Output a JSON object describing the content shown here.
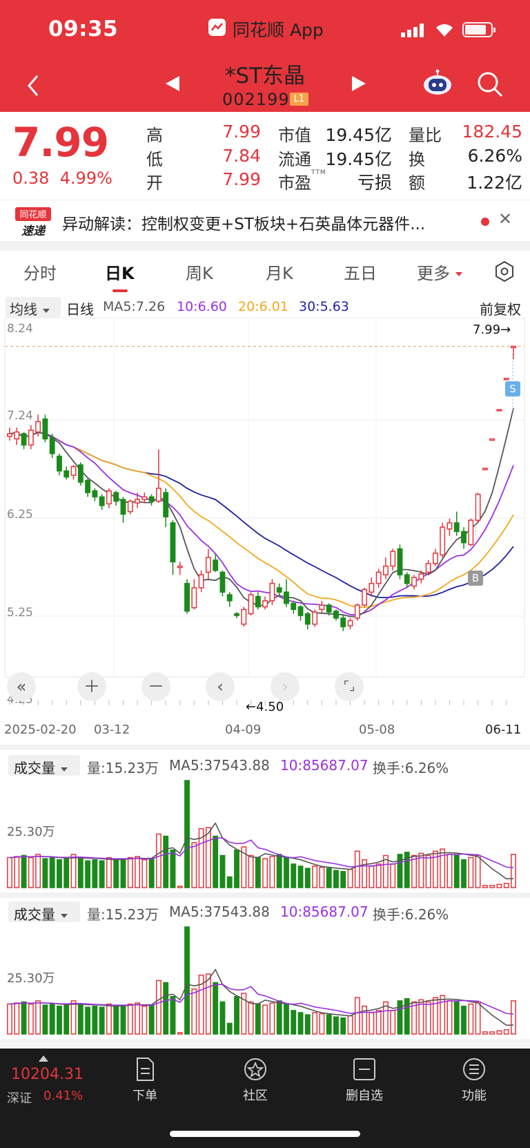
{
  "status": {
    "time": "09:35",
    "app": "同花顺 App"
  },
  "stock": {
    "name": "*ST东晶",
    "code": "002199",
    "level": "L1"
  },
  "quote": {
    "price": "7.99",
    "change": "0.38",
    "pct": "4.99%",
    "labels": {
      "high": "高",
      "low": "低",
      "open": "开",
      "mcap": "市值",
      "float": "流通",
      "pe": "市盈",
      "pe_sup": "TTM",
      "ratio": "量比",
      "turn": "换",
      "amount": "额"
    },
    "high": "7.99",
    "low": "7.84",
    "open": "7.99",
    "mcap": "19.45亿",
    "float": "19.45亿",
    "pe": "亏损",
    "ratio": "182.45",
    "turn": "6.26%",
    "amount": "1.22亿"
  },
  "news": {
    "badge_top": "同花顺",
    "badge_bottom": "速递",
    "text": "异动解读：控制权变更+ST板块+石英晶体元器件..."
  },
  "tabs": [
    "分时",
    "日K",
    "周K",
    "月K",
    "五日",
    "更多"
  ],
  "active_tab": 1,
  "ma_bar": {
    "selector": "均线",
    "period": "日线",
    "ma5": "MA5:7.26",
    "ma10": "10:6.60",
    "ma20": "20:6.01",
    "ma30": "30:5.63",
    "adjust": "前复权"
  },
  "price_axis": {
    "p1": "8.24",
    "p2": "7.24",
    "p3": "6.25",
    "p4": "5.25",
    "p5": "4.25",
    "max_label": "7.99→",
    "min_label": "←4.50"
  },
  "date_axis": [
    "2025-02-20",
    "03-12",
    "04-09",
    "05-08",
    "06-11"
  ],
  "markers": {
    "sell": "S",
    "buy": "B"
  },
  "volume_panels": [
    {
      "selector": "成交量",
      "vol": "量:15.23万",
      "ma5": "MA5:37543.88",
      "ma10": "10:85687.07",
      "turn": "换手:6.26%",
      "axis": "25.30万"
    },
    {
      "selector": "成交量",
      "vol": "量:15.23万",
      "ma5": "MA5:37543.88",
      "ma10": "10:85687.07",
      "turn": "换手:6.26%",
      "axis": "25.30万"
    }
  ],
  "footer": {
    "index_value": "10204.31",
    "index_name": "深证",
    "index_pct": "0.41%",
    "items": [
      "下单",
      "社区",
      "删自选",
      "功能"
    ]
  },
  "colors": {
    "brand_red": "#e5343b",
    "down_green": "#1a8a1a",
    "ma5": "#555555",
    "ma10": "#9b30e0",
    "ma20": "#f2a81d",
    "ma30": "#1f1fa0"
  },
  "chart_data": {
    "type": "candlestick",
    "title": "",
    "ylim": [
      4.25,
      8.24
    ],
    "x_ticks": [
      "2025-02-20",
      "03-12",
      "04-09",
      "05-08",
      "06-11"
    ],
    "candles": [
      [
        6.95,
        6.98,
        6.9,
        7.05
      ],
      [
        6.92,
        7.0,
        6.85,
        7.05
      ],
      [
        6.98,
        6.85,
        6.8,
        7.0
      ],
      [
        6.85,
        7.02,
        6.8,
        7.08
      ],
      [
        7.0,
        7.12,
        6.95,
        7.2
      ],
      [
        7.15,
        6.92,
        6.88,
        7.2
      ],
      [
        6.93,
        6.75,
        6.7,
        6.98
      ],
      [
        6.72,
        6.55,
        6.5,
        6.75
      ],
      [
        6.55,
        6.48,
        6.45,
        6.6
      ],
      [
        6.5,
        6.6,
        6.45,
        6.62
      ],
      [
        6.62,
        6.42,
        6.38,
        6.65
      ],
      [
        6.44,
        6.3,
        6.25,
        6.46
      ],
      [
        6.32,
        6.25,
        6.2,
        6.35
      ],
      [
        6.25,
        6.15,
        6.1,
        6.28
      ],
      [
        6.17,
        6.32,
        6.12,
        6.35
      ],
      [
        6.3,
        6.2,
        6.15,
        6.32
      ],
      [
        6.22,
        6.05,
        5.95,
        6.25
      ],
      [
        6.08,
        6.2,
        6.05,
        6.22
      ],
      [
        6.18,
        6.22,
        6.12,
        6.3
      ],
      [
        6.22,
        6.25,
        6.18,
        6.3
      ],
      [
        6.25,
        6.2,
        6.15,
        6.28
      ],
      [
        6.2,
        6.35,
        6.18,
        6.8
      ],
      [
        6.3,
        6.02,
        5.9,
        6.35
      ],
      [
        5.95,
        5.5,
        5.35,
        5.98
      ],
      [
        5.45,
        5.45,
        5.35,
        5.5
      ],
      [
        5.25,
        4.93,
        4.9,
        5.3
      ],
      [
        4.97,
        5.2,
        4.95,
        5.3
      ],
      [
        5.2,
        5.35,
        5.15,
        5.4
      ],
      [
        5.38,
        5.55,
        5.3,
        5.65
      ],
      [
        5.52,
        5.4,
        5.38,
        5.6
      ],
      [
        5.38,
        5.15,
        5.1,
        5.4
      ],
      [
        5.12,
        5.05,
        4.98,
        5.15
      ],
      [
        4.9,
        4.88,
        4.85,
        4.92
      ],
      [
        4.78,
        4.95,
        4.75,
        4.98
      ],
      [
        4.9,
        5.12,
        4.88,
        5.15
      ],
      [
        5.1,
        4.98,
        4.95,
        5.15
      ],
      [
        4.98,
        5.05,
        4.95,
        5.1
      ],
      [
        5.05,
        5.25,
        5.0,
        5.3
      ],
      [
        5.2,
        5.15,
        5.1,
        5.25
      ],
      [
        5.15,
        5.02,
        4.98,
        5.3
      ],
      [
        5.02,
        4.95,
        4.9,
        5.05
      ],
      [
        4.98,
        4.88,
        4.82,
        5.0
      ],
      [
        4.9,
        4.78,
        4.72,
        4.92
      ],
      [
        4.78,
        4.92,
        4.75,
        4.95
      ],
      [
        4.95,
        5.0,
        4.9,
        5.05
      ],
      [
        5.0,
        4.92,
        4.88,
        5.02
      ],
      [
        4.93,
        4.85,
        4.82,
        4.95
      ],
      [
        4.85,
        4.75,
        4.7,
        4.88
      ],
      [
        4.76,
        4.82,
        4.72,
        4.85
      ],
      [
        4.85,
        5.0,
        4.82,
        5.02
      ],
      [
        5.0,
        5.18,
        4.98,
        5.2
      ],
      [
        5.15,
        5.25,
        5.1,
        5.32
      ],
      [
        5.25,
        5.38,
        5.2,
        5.42
      ],
      [
        5.35,
        5.45,
        5.3,
        5.55
      ],
      [
        5.45,
        5.62,
        5.4,
        5.65
      ],
      [
        5.65,
        5.35,
        5.3,
        5.7
      ],
      [
        5.35,
        5.25,
        5.2,
        5.38
      ],
      [
        5.22,
        5.32,
        5.18,
        5.35
      ],
      [
        5.3,
        5.36,
        5.25,
        5.4
      ],
      [
        5.38,
        5.48,
        5.35,
        5.52
      ],
      [
        5.48,
        5.6,
        5.45,
        5.65
      ],
      [
        5.58,
        5.9,
        5.55,
        5.95
      ],
      [
        5.88,
        5.95,
        5.8,
        6.0
      ],
      [
        5.95,
        5.85,
        5.8,
        6.08
      ],
      [
        5.85,
        5.72,
        5.65,
        5.9
      ],
      [
        5.7,
        5.98,
        5.68,
        6.0
      ],
      [
        5.98,
        6.28,
        5.95,
        6.3
      ],
      [
        6.58,
        6.58,
        6.58,
        6.58
      ],
      [
        6.92,
        6.92,
        6.92,
        6.92
      ],
      [
        7.26,
        7.26,
        7.26,
        7.26
      ],
      [
        7.62,
        7.62,
        7.62,
        7.62
      ],
      [
        7.99,
        7.99,
        7.84,
        7.99
      ]
    ],
    "volume_bars": [
      0.28,
      0.29,
      0.3,
      0.28,
      0.31,
      0.27,
      0.28,
      0.26,
      0.27,
      0.31,
      0.28,
      0.25,
      0.26,
      0.25,
      0.28,
      0.26,
      0.27,
      0.28,
      0.29,
      0.26,
      0.27,
      0.5,
      0.48,
      0.35,
      0.0,
      1.0,
      0.42,
      0.55,
      0.56,
      0.48,
      0.3,
      0.1,
      0.35,
      0.38,
      0.3,
      0.28,
      0.27,
      0.29,
      0.31,
      0.28,
      0.22,
      0.2,
      0.18,
      0.2,
      0.19,
      0.18,
      0.16,
      0.15,
      0.17,
      0.34,
      0.26,
      0.2,
      0.22,
      0.3,
      0.22,
      0.31,
      0.33,
      0.3,
      0.32,
      0.3,
      0.34,
      0.36,
      0.31,
      0.3,
      0.26,
      0.28,
      0.3,
      0.02,
      0.02,
      0.03,
      0.04,
      0.31
    ]
  }
}
